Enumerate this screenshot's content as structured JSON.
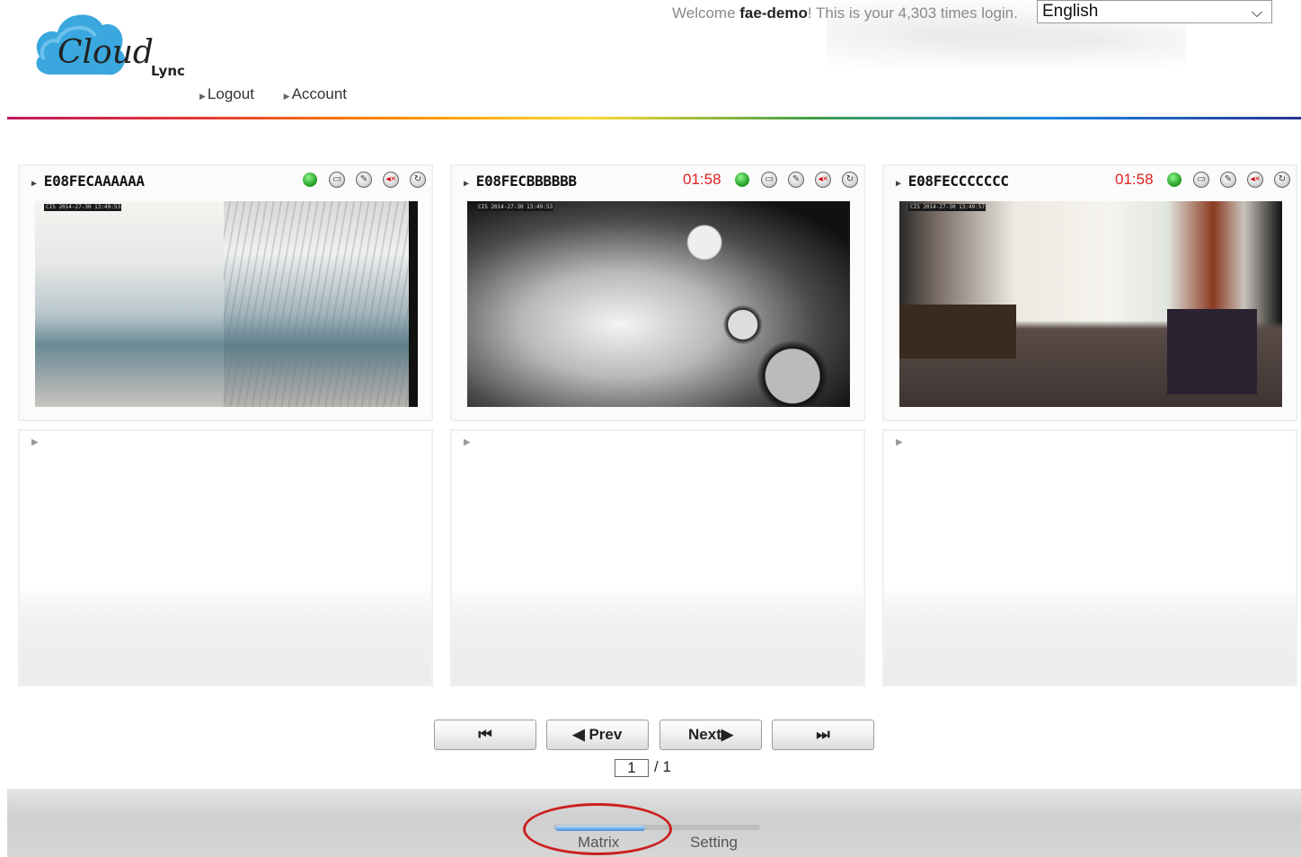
{
  "header": {
    "logo_text": "Cloud",
    "logo_subtext": "Lync",
    "welcome_prefix": "Welcome ",
    "username": "fae-demo",
    "welcome_suffix": "! This is your 4,303 times login.",
    "language": "English",
    "links": [
      "Logout",
      "Account"
    ]
  },
  "cameras": [
    {
      "name": "E08FECAAAAAA",
      "timer": "",
      "status_color": "#2aa52a",
      "stamp": "CIS 2014-27-30 13:49:53",
      "icons": [
        "status-led-icon",
        "snapshot-icon",
        "settings-wrench-icon",
        "mute-speaker-icon",
        "refresh-icon"
      ]
    },
    {
      "name": "E08FECBBBBBB",
      "timer": "01:58",
      "status_color": "#2aa52a",
      "stamp": "CIS 2014-27-30 13:49:53",
      "icons": [
        "status-led-icon",
        "snapshot-icon",
        "settings-wrench-icon",
        "mute-speaker-icon",
        "refresh-icon"
      ]
    },
    {
      "name": "E08FECCCCCCC",
      "timer": "01:58",
      "status_color": "#2aa52a",
      "stamp": "CIS 2014-27-30 13:49:57",
      "icons": [
        "status-led-icon",
        "snapshot-icon",
        "settings-wrench-icon",
        "mute-speaker-icon",
        "refresh-icon"
      ]
    }
  ],
  "pager": {
    "first_label": "⏮",
    "prev_label": "◀ Prev",
    "next_label": "Next▶",
    "last_label": "⏭",
    "current_page": "1",
    "total_pages": "/ 1"
  },
  "tabs": [
    {
      "label": "Matrix",
      "active": true
    },
    {
      "label": "Setting",
      "active": false
    }
  ],
  "colors": {
    "accent_blue": "#3f8fd8",
    "timer_red": "#e02020",
    "highlight": "#cc2020"
  }
}
